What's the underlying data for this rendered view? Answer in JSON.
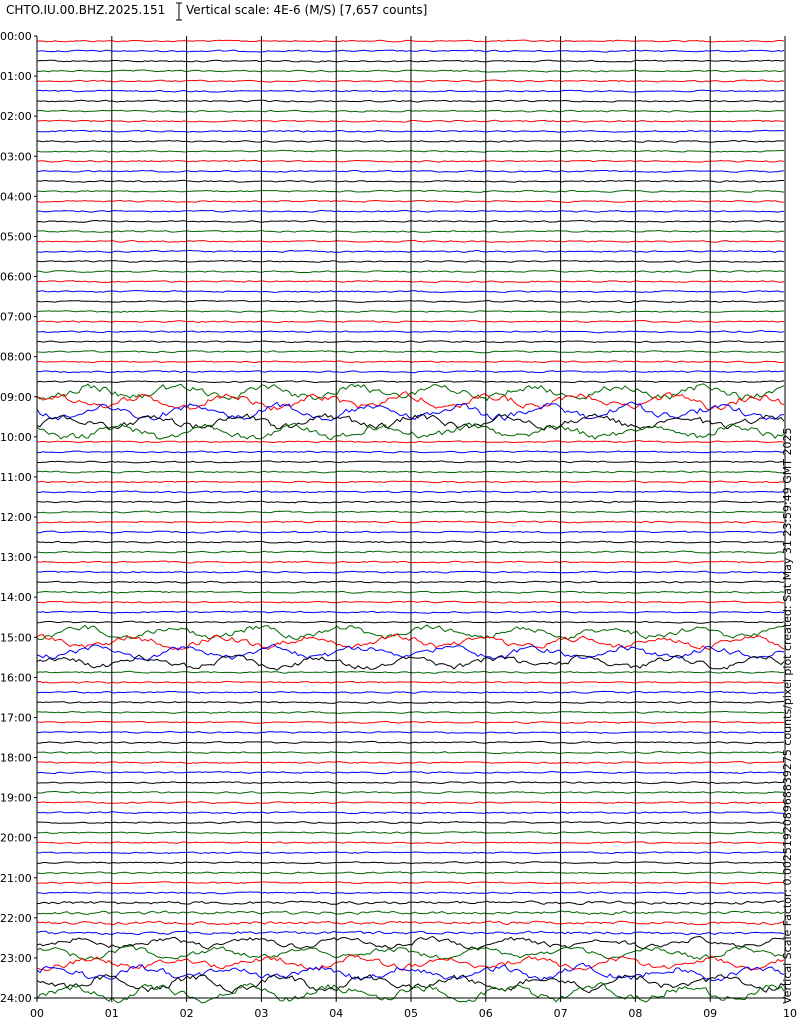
{
  "header": {
    "station": "CHTO.IU.00.BHZ.2025.151",
    "scale_text": "Vertical scale: 4E-6 (M/S) [7,657 counts]"
  },
  "side_note": "Vertical Scale Factor: 0.002519208968839275 counts/pixel plot created: Sat May 31 23:59:49 GMT 2025",
  "colors": {
    "trace_cycle": [
      "#ff0000",
      "#0000ff",
      "#000000",
      "#006600"
    ],
    "grid": "#000000"
  },
  "chart_data": {
    "type": "line",
    "kind": "helicorder",
    "lines_per_hour": 4,
    "trace_color_order": [
      "red",
      "blue",
      "black",
      "green"
    ],
    "x_ticks": [
      "00",
      "01",
      "02",
      "03",
      "04",
      "05",
      "06",
      "07",
      "08",
      "09",
      "10"
    ],
    "xlim": [
      0,
      10
    ],
    "y_ticks": [
      "00:00",
      "01:00",
      "02:00",
      "03:00",
      "04:00",
      "05:00",
      "06:00",
      "07:00",
      "08:00",
      "09:00",
      "10:00",
      "11:00",
      "12:00",
      "13:00",
      "14:00",
      "15:00",
      "16:00",
      "17:00",
      "18:00",
      "19:00",
      "20:00",
      "21:00",
      "22:00",
      "23:00",
      "24:00"
    ],
    "ylim": [
      "00:00",
      "24:00"
    ],
    "grid": true
  }
}
